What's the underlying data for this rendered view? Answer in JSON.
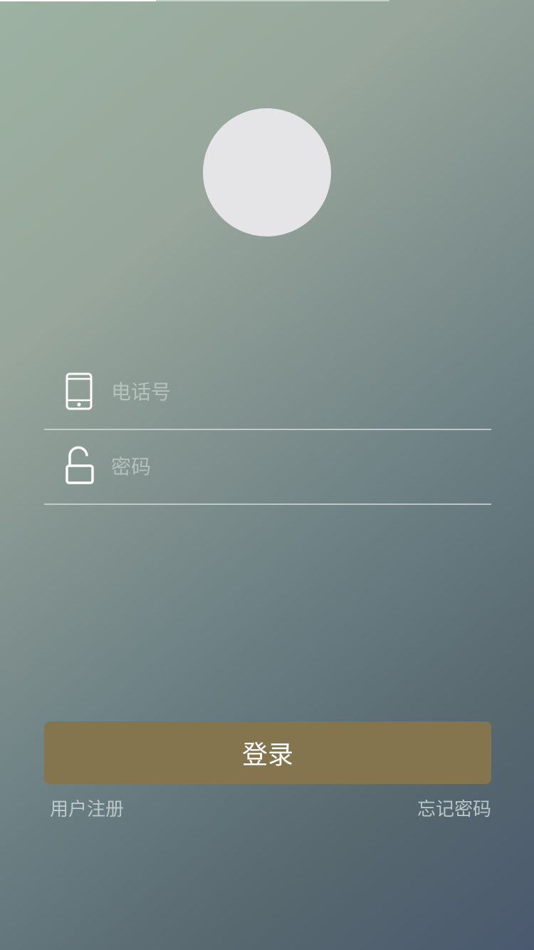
{
  "status": {
    "progress_fraction": 0.4
  },
  "form": {
    "phone_placeholder": "电话号",
    "password_placeholder": "密码",
    "phone_icon": "mobile-phone-icon",
    "password_icon": "unlocked-padlock-icon"
  },
  "actions": {
    "login_label": "登录",
    "register_label": "用户注册",
    "forgot_label": "忘记密码"
  },
  "colors": {
    "login_button": "#85754f",
    "avatar": "#e5e5e7",
    "background_top": "#9cb2a3",
    "background_bottom": "#4a596f"
  }
}
